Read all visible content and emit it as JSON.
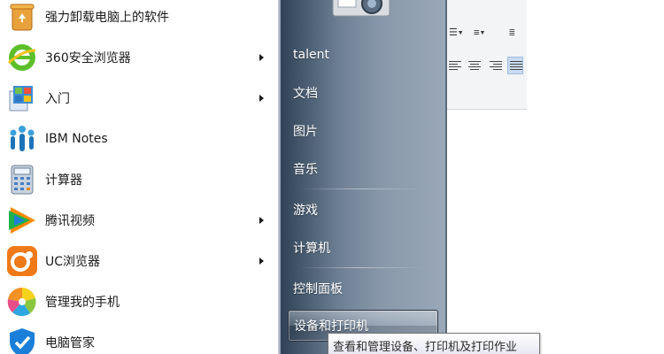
{
  "programs": [
    {
      "label": "强力卸载电脑上的软件",
      "icon": "recycle-bin-icon",
      "has_submenu": false
    },
    {
      "label": "360安全浏览器",
      "icon": "360-browser-icon",
      "has_submenu": true
    },
    {
      "label": "入门",
      "icon": "getting-started-icon",
      "has_submenu": true
    },
    {
      "label": "IBM Notes",
      "icon": "ibm-notes-icon",
      "has_submenu": false
    },
    {
      "label": "计算器",
      "icon": "calculator-icon",
      "has_submenu": false
    },
    {
      "label": "腾讯视频",
      "icon": "tencent-video-icon",
      "has_submenu": true
    },
    {
      "label": "UC浏览器",
      "icon": "uc-browser-icon",
      "has_submenu": true
    },
    {
      "label": "管理我的手机",
      "icon": "phone-manager-icon",
      "has_submenu": false
    },
    {
      "label": "电脑管家",
      "icon": "pc-manager-icon",
      "has_submenu": false
    }
  ],
  "places": [
    {
      "label": "talent"
    },
    {
      "label": "文档"
    },
    {
      "label": "图片"
    },
    {
      "label": "音乐"
    },
    {
      "label": "游戏"
    },
    {
      "label": "计算机"
    },
    {
      "label": "控制面板"
    },
    {
      "label": "设备和打印机",
      "selected": true
    }
  ],
  "tooltip": {
    "text": "查看和管理设备、打印机及打印作业"
  },
  "colors": {
    "places_dark": "#2f4256",
    "places_light": "#9aa8b8",
    "selection_highlight": "#c9dbf1"
  }
}
